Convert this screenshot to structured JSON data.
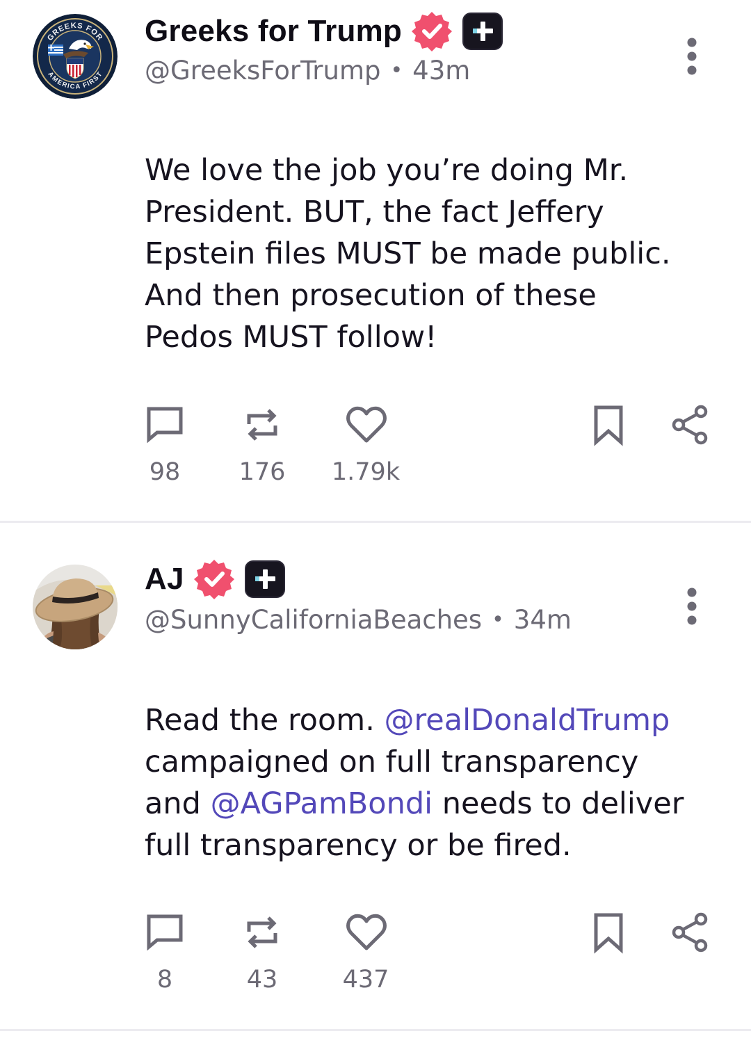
{
  "posts": [
    {
      "display_name": "Greeks for Trump",
      "handle": "@GreeksForTrump",
      "separator": "•",
      "time": "43m",
      "avatar_text_top": "GREEKS FOR",
      "avatar_text_bottom": "AMERICA FIRST",
      "text_parts": [
        {
          "text": "We love the job you’re doing Mr.\nPresident. BUT, the fact Jeffery\nEpstein files MUST be made public.\nAnd then prosecution of these\nPedos MUST follow!",
          "mention": false
        }
      ],
      "replies": "98",
      "reposts": "176",
      "likes": "1.79k"
    },
    {
      "display_name": "AJ",
      "handle": "@SunnyCaliforniaBeaches",
      "separator": "•",
      "time": "34m",
      "text_parts": [
        {
          "text": "Read the room. ",
          "mention": false
        },
        {
          "text": "@realDonaldTrump",
          "mention": true
        },
        {
          "text": "\ncampaigned on full transparency\nand ",
          "mention": false
        },
        {
          "text": "@AGPamBondi",
          "mention": true
        },
        {
          "text": " needs to deliver\nfull transparency or be fired.",
          "mention": false
        }
      ],
      "replies": "8",
      "reposts": "43",
      "likes": "437"
    }
  ],
  "colors": {
    "accent_mention": "#5348b9",
    "verified_badge": "#f0506e",
    "plus_badge": "#17151f",
    "icon_gray": "#6c6a75"
  },
  "icons": [
    "comment-icon",
    "repost-icon",
    "heart-icon",
    "bookmark-icon",
    "share-icon",
    "more-vertical-icon",
    "verified-badge-icon",
    "plus-badge-icon"
  ]
}
